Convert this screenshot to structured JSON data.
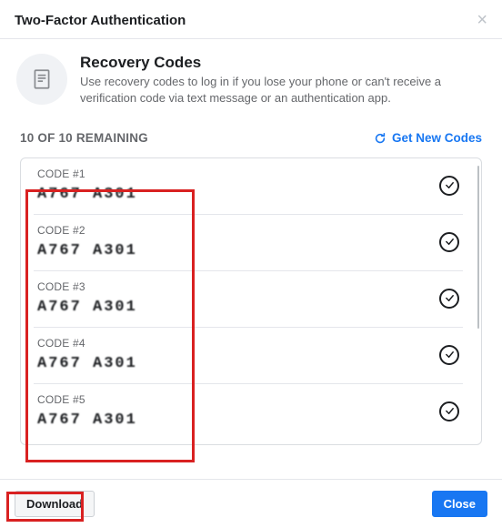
{
  "header": {
    "title": "Two-Factor Authentication"
  },
  "intro": {
    "heading": "Recovery Codes",
    "description": "Use recovery codes to log in if you lose your phone or can't receive a verification code via text message or an authentication app."
  },
  "status": {
    "remaining_text": "10 OF 10 REMAINING",
    "get_new_label": "Get New Codes"
  },
  "codes": [
    {
      "label": "CODE #1",
      "value": "A767 A301",
      "used": false
    },
    {
      "label": "CODE #2",
      "value": "A767 A301",
      "used": false
    },
    {
      "label": "CODE #3",
      "value": "A767 A301",
      "used": false
    },
    {
      "label": "CODE #4",
      "value": "A767 A301",
      "used": false
    },
    {
      "label": "CODE #5",
      "value": "A767 A301",
      "used": false
    }
  ],
  "footer": {
    "download_label": "Download",
    "close_label": "Close"
  }
}
